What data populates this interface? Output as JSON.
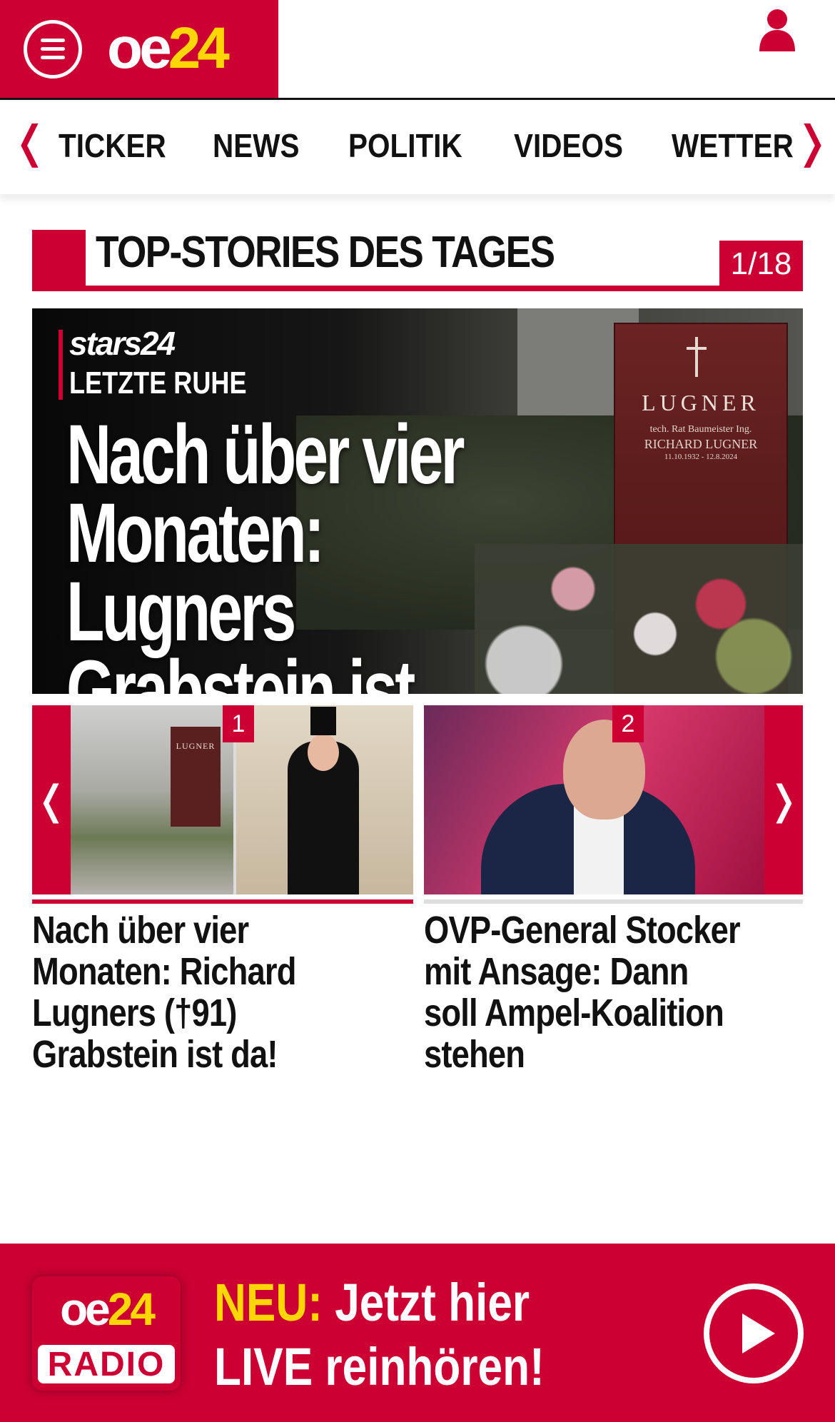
{
  "header": {
    "brand_oe": "oe",
    "brand_24": "24",
    "menu_icon": "hamburger-menu-icon",
    "user_icon": "user-icon"
  },
  "nav": {
    "items": [
      "TICKER",
      "NEWS",
      "POLITIK",
      "VIDEOS",
      "WETTER"
    ],
    "prev_arrow": "❬",
    "next_arrow": "❭"
  },
  "section": {
    "title": "TOP-STORIES DES TAGES",
    "counter": "1/18"
  },
  "hero": {
    "brand": "stars24",
    "kicker": "LETZTE RUHE",
    "headline": "Nach über vier Monaten: Lugners Grabstein ist da!",
    "stone_name": "LUGNER",
    "stone_line1": "tech. Rat Baumeister Ing.",
    "stone_line2": "RICHARD LUGNER",
    "stone_line3": "11.10.1932 - 12.8.2024"
  },
  "thumbs": {
    "prev": "❬",
    "next": "❭",
    "items": [
      {
        "number": "1",
        "headline": "Nach über vier Monaten: Richard Lugners (†91) Grabstein ist da!",
        "photo_text": "LUGNER"
      },
      {
        "number": "2",
        "headline": "OVP-General Stocker mit Ansage: Dann soll Ampel-Koalition stehen"
      }
    ]
  },
  "radio": {
    "logo_oe": "oe",
    "logo_24": "24",
    "logo_radio": "RADIO",
    "neu": "NEU:",
    "line1": "Jetzt hier",
    "line2": "LIVE reinhören!",
    "play_icon": "play-icon"
  },
  "colors": {
    "brand_red": "#cc0033",
    "brand_yellow": "#ffd700"
  }
}
